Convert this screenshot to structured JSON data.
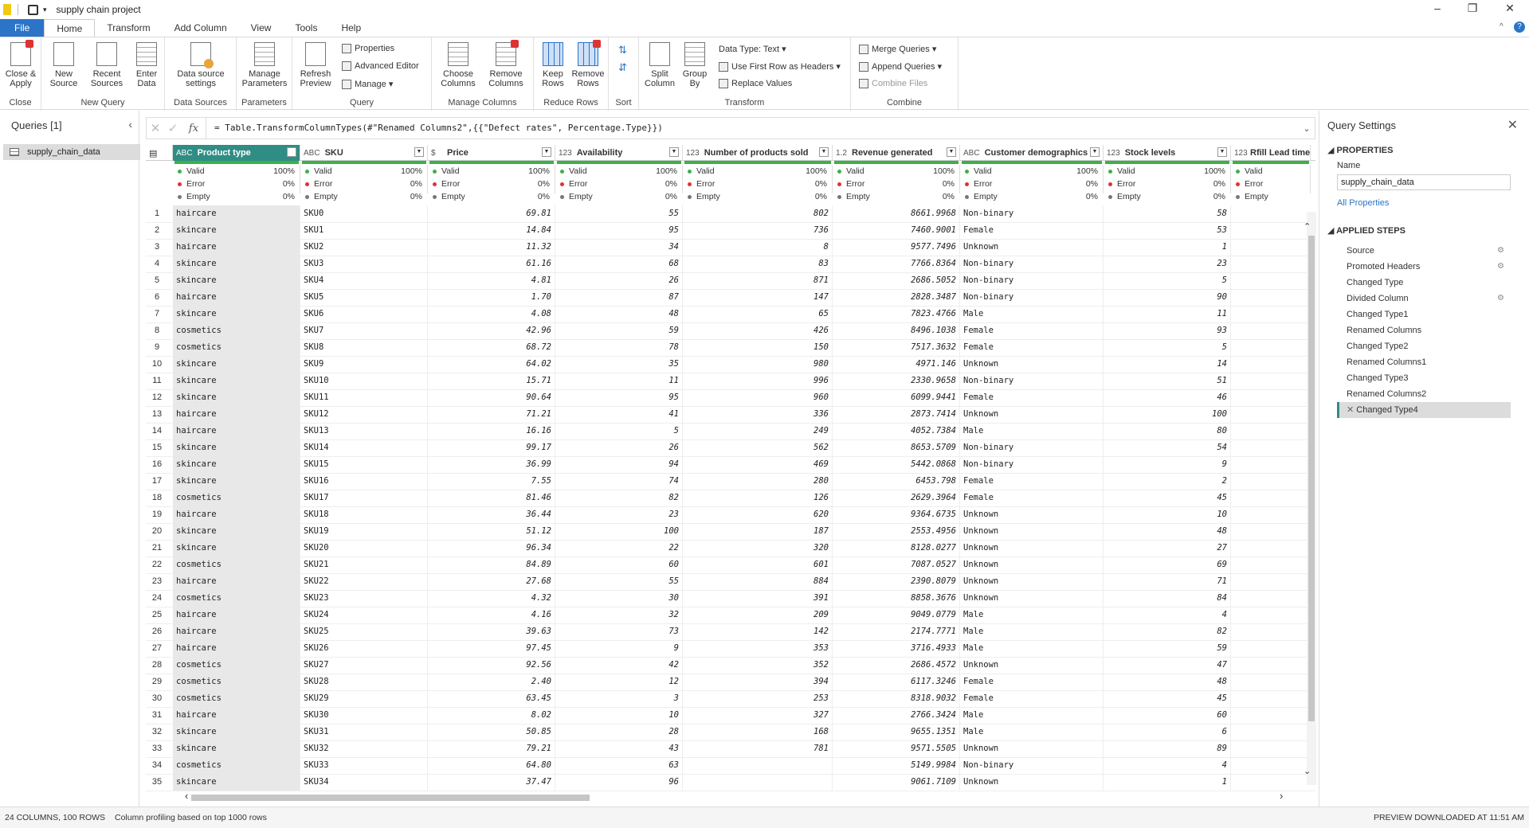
{
  "title": "supply chain project",
  "tabs": [
    "File",
    "Home",
    "Transform",
    "Add Column",
    "View",
    "Tools",
    "Help"
  ],
  "ribbon": {
    "groups": [
      "Close",
      "New Query",
      "Data Sources",
      "Parameters",
      "Query",
      "Manage Columns",
      "Reduce Rows",
      "Sort",
      "Transform",
      "Combine"
    ],
    "close_apply": "Close & Apply",
    "new_source": "New Source",
    "recent_sources": "Recent Sources",
    "enter_data": "Enter Data",
    "data_source_settings": "Data source settings",
    "manage_parameters": "Manage Parameters",
    "refresh_preview": "Refresh Preview",
    "properties": "Properties",
    "advanced_editor": "Advanced Editor",
    "manage": "Manage",
    "choose_columns": "Choose Columns",
    "remove_columns": "Remove Columns",
    "keep_rows": "Keep Rows",
    "remove_rows": "Remove Rows",
    "split_column": "Split Column",
    "group_by": "Group By",
    "data_type": "Data Type: Text",
    "use_first_row": "Use First Row as Headers",
    "replace_values": "Replace Values",
    "merge_queries": "Merge Queries",
    "append_queries": "Append Queries",
    "combine_files": "Combine Files"
  },
  "queries": {
    "header": "Queries [1]",
    "item": "supply_chain_data"
  },
  "formula": "= Table.TransformColumnTypes(#\"Renamed Columns2\",{{\"Defect rates\", Percentage.Type}})",
  "columns": [
    {
      "type": "ABC",
      "name": "Product type"
    },
    {
      "type": "ABC",
      "name": "SKU"
    },
    {
      "type": "$",
      "name": "Price"
    },
    {
      "type": "123",
      "name": "Availability"
    },
    {
      "type": "123",
      "name": "Number of products sold"
    },
    {
      "type": "1.2",
      "name": "Revenue generated"
    },
    {
      "type": "ABC",
      "name": "Customer demographics"
    },
    {
      "type": "123",
      "name": "Stock levels"
    },
    {
      "type": "123",
      "name": "Rfill Lead times"
    }
  ],
  "profile": {
    "valid": "Valid",
    "error": "Error",
    "empty": "Empty",
    "valid_pct": "100%",
    "error_pct": "0%",
    "empty_pct": "0%"
  },
  "rows": [
    [
      "haircare",
      "SKU0",
      "69.81",
      "55",
      "802",
      "8661.9968",
      "Non-binary",
      "58"
    ],
    [
      "skincare",
      "SKU1",
      "14.84",
      "95",
      "736",
      "7460.9001",
      "Female",
      "53"
    ],
    [
      "haircare",
      "SKU2",
      "11.32",
      "34",
      "8",
      "9577.7496",
      "Unknown",
      "1"
    ],
    [
      "skincare",
      "SKU3",
      "61.16",
      "68",
      "83",
      "7766.8364",
      "Non-binary",
      "23"
    ],
    [
      "skincare",
      "SKU4",
      "4.81",
      "26",
      "871",
      "2686.5052",
      "Non-binary",
      "5"
    ],
    [
      "haircare",
      "SKU5",
      "1.70",
      "87",
      "147",
      "2828.3487",
      "Non-binary",
      "90"
    ],
    [
      "skincare",
      "SKU6",
      "4.08",
      "48",
      "65",
      "7823.4766",
      "Male",
      "11"
    ],
    [
      "cosmetics",
      "SKU7",
      "42.96",
      "59",
      "426",
      "8496.1038",
      "Female",
      "93"
    ],
    [
      "cosmetics",
      "SKU8",
      "68.72",
      "78",
      "150",
      "7517.3632",
      "Female",
      "5"
    ],
    [
      "skincare",
      "SKU9",
      "64.02",
      "35",
      "980",
      "4971.146",
      "Unknown",
      "14"
    ],
    [
      "skincare",
      "SKU10",
      "15.71",
      "11",
      "996",
      "2330.9658",
      "Non-binary",
      "51"
    ],
    [
      "skincare",
      "SKU11",
      "90.64",
      "95",
      "960",
      "6099.9441",
      "Female",
      "46"
    ],
    [
      "haircare",
      "SKU12",
      "71.21",
      "41",
      "336",
      "2873.7414",
      "Unknown",
      "100"
    ],
    [
      "haircare",
      "SKU13",
      "16.16",
      "5",
      "249",
      "4052.7384",
      "Male",
      "80"
    ],
    [
      "skincare",
      "SKU14",
      "99.17",
      "26",
      "562",
      "8653.5709",
      "Non-binary",
      "54"
    ],
    [
      "skincare",
      "SKU15",
      "36.99",
      "94",
      "469",
      "5442.0868",
      "Non-binary",
      "9"
    ],
    [
      "skincare",
      "SKU16",
      "7.55",
      "74",
      "280",
      "6453.798",
      "Female",
      "2"
    ],
    [
      "cosmetics",
      "SKU17",
      "81.46",
      "82",
      "126",
      "2629.3964",
      "Female",
      "45"
    ],
    [
      "haircare",
      "SKU18",
      "36.44",
      "23",
      "620",
      "9364.6735",
      "Unknown",
      "10"
    ],
    [
      "skincare",
      "SKU19",
      "51.12",
      "100",
      "187",
      "2553.4956",
      "Unknown",
      "48"
    ],
    [
      "skincare",
      "SKU20",
      "96.34",
      "22",
      "320",
      "8128.0277",
      "Unknown",
      "27"
    ],
    [
      "cosmetics",
      "SKU21",
      "84.89",
      "60",
      "601",
      "7087.0527",
      "Unknown",
      "69"
    ],
    [
      "haircare",
      "SKU22",
      "27.68",
      "55",
      "884",
      "2390.8079",
      "Unknown",
      "71"
    ],
    [
      "cosmetics",
      "SKU23",
      "4.32",
      "30",
      "391",
      "8858.3676",
      "Unknown",
      "84"
    ],
    [
      "haircare",
      "SKU24",
      "4.16",
      "32",
      "209",
      "9049.0779",
      "Male",
      "4"
    ],
    [
      "haircare",
      "SKU25",
      "39.63",
      "73",
      "142",
      "2174.7771",
      "Male",
      "82"
    ],
    [
      "haircare",
      "SKU26",
      "97.45",
      "9",
      "353",
      "3716.4933",
      "Male",
      "59"
    ],
    [
      "cosmetics",
      "SKU27",
      "92.56",
      "42",
      "352",
      "2686.4572",
      "Unknown",
      "47"
    ],
    [
      "cosmetics",
      "SKU28",
      "2.40",
      "12",
      "394",
      "6117.3246",
      "Female",
      "48"
    ],
    [
      "cosmetics",
      "SKU29",
      "63.45",
      "3",
      "253",
      "8318.9032",
      "Female",
      "45"
    ],
    [
      "haircare",
      "SKU30",
      "8.02",
      "10",
      "327",
      "2766.3424",
      "Male",
      "60"
    ],
    [
      "skincare",
      "SKU31",
      "50.85",
      "28",
      "168",
      "9655.1351",
      "Male",
      "6"
    ],
    [
      "skincare",
      "SKU32",
      "79.21",
      "43",
      "781",
      "9571.5505",
      "Unknown",
      "89"
    ],
    [
      "cosmetics",
      "SKU33",
      "64.80",
      "63",
      "",
      "5149.9984",
      "Non-binary",
      "4"
    ],
    [
      "skincare",
      "SKU34",
      "37.47",
      "96",
      "",
      "9061.7109",
      "Unknown",
      "1"
    ]
  ],
  "settings": {
    "title": "Query Settings",
    "properties": "PROPERTIES",
    "name_label": "Name",
    "name_value": "supply_chain_data",
    "all_properties": "All Properties",
    "applied_steps": "APPLIED STEPS",
    "steps": [
      "Source",
      "Promoted Headers",
      "Changed Type",
      "Divided Column",
      "Changed Type1",
      "Renamed Columns",
      "Changed Type2",
      "Renamed Columns1",
      "Changed Type3",
      "Renamed Columns2",
      "Changed Type4"
    ]
  },
  "status": {
    "left": "24 COLUMNS, 100 ROWS",
    "profiling": "Column profiling based on top 1000 rows",
    "right": "PREVIEW DOWNLOADED AT 11:51 AM"
  },
  "colors": {
    "accent": "#2f8d85",
    "file_tab": "#2b74c8",
    "valid": "#3db04a"
  }
}
